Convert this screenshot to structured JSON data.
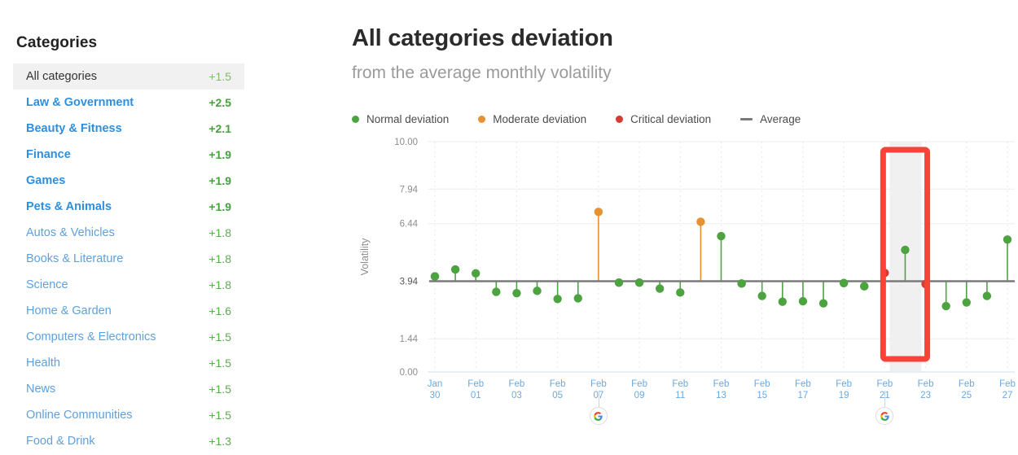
{
  "sidebar": {
    "title": "Categories",
    "items": [
      {
        "label": "All categories",
        "value": "+1.5",
        "selected": true,
        "strong": false,
        "value_color": "green"
      },
      {
        "label": "Law & Government",
        "value": "+2.5",
        "selected": false,
        "strong": true,
        "value_color": "orange"
      },
      {
        "label": "Beauty & Fitness",
        "value": "+2.1",
        "selected": false,
        "strong": true,
        "value_color": "green"
      },
      {
        "label": "Finance",
        "value": "+1.9",
        "selected": false,
        "strong": true,
        "value_color": "green"
      },
      {
        "label": "Games",
        "value": "+1.9",
        "selected": false,
        "strong": true,
        "value_color": "green"
      },
      {
        "label": "Pets & Animals",
        "value": "+1.9",
        "selected": false,
        "strong": true,
        "value_color": "green"
      },
      {
        "label": "Autos & Vehicles",
        "value": "+1.8",
        "selected": false,
        "strong": false,
        "value_color": "green"
      },
      {
        "label": "Books & Literature",
        "value": "+1.8",
        "selected": false,
        "strong": false,
        "value_color": "green"
      },
      {
        "label": "Science",
        "value": "+1.8",
        "selected": false,
        "strong": false,
        "value_color": "green"
      },
      {
        "label": "Home & Garden",
        "value": "+1.6",
        "selected": false,
        "strong": false,
        "value_color": "green"
      },
      {
        "label": "Computers & Electronics",
        "value": "+1.5",
        "selected": false,
        "strong": false,
        "value_color": "green"
      },
      {
        "label": "Health",
        "value": "+1.5",
        "selected": false,
        "strong": false,
        "value_color": "green"
      },
      {
        "label": "News",
        "value": "+1.5",
        "selected": false,
        "strong": false,
        "value_color": "green"
      },
      {
        "label": "Online Communities",
        "value": "+1.5",
        "selected": false,
        "strong": false,
        "value_color": "green"
      },
      {
        "label": "Food & Drink",
        "value": "+1.3",
        "selected": false,
        "strong": false,
        "value_color": "green"
      }
    ]
  },
  "header": {
    "title": "All categories deviation",
    "subtitle": "from the average monthly volatility"
  },
  "colors": {
    "normal": "#4ca340",
    "moderate": "#e59331",
    "critical": "#d23c32",
    "average_line": "#7a7a7a",
    "annotation_box": "#f9423a",
    "category_link": "#5fa0dc",
    "category_value": "#5cab4e",
    "axis_label": "#6aa9e0"
  },
  "markers": [
    {
      "name": "google-update-marker",
      "x_label": "Feb 07"
    },
    {
      "name": "google-update-marker",
      "x_label": "Feb 21"
    }
  ],
  "annotation": {
    "name": "highlight-box",
    "x_from": "Feb 21",
    "x_to": "Feb 22",
    "color": "#f9423a"
  },
  "chart_data": {
    "type": "scatter",
    "title": "All categories deviation",
    "subtitle": "from the average monthly volatility",
    "xlabel": "",
    "ylabel": "Volatility",
    "ylim": [
      0.0,
      10.0
    ],
    "ytick_values": [
      0.0,
      1.44,
      3.94,
      6.44,
      7.94,
      10.0
    ],
    "ytick_labels": [
      "0.00",
      "1.44",
      "3.94",
      "6.44",
      "7.94",
      "10.00"
    ],
    "average": 3.94,
    "average_label": "Average",
    "grid": true,
    "legend_position": "top-left",
    "legend": [
      {
        "label": "Normal deviation",
        "color": "#4ca340",
        "key": "normal"
      },
      {
        "label": "Moderate deviation",
        "color": "#e59331",
        "key": "moderate"
      },
      {
        "label": "Critical deviation",
        "color": "#d23c32",
        "key": "critical"
      },
      {
        "label": "Average",
        "color": "#7a7a7a",
        "key": "average"
      }
    ],
    "xtick_labels": [
      "Jan\n30",
      "Feb\n01",
      "Feb\n03",
      "Feb\n05",
      "Feb\n07",
      "Feb\n09",
      "Feb\n11",
      "Feb\n13",
      "Feb\n15",
      "Feb\n17",
      "Feb\n19",
      "Feb\n21",
      "Feb\n23",
      "Feb\n25",
      "Feb\n27"
    ],
    "points": [
      {
        "x_label": "Jan 30",
        "value": 4.15,
        "level": "normal"
      },
      {
        "x_label": "Jan 31",
        "value": 4.45,
        "level": "normal"
      },
      {
        "x_label": "Feb 01",
        "value": 4.28,
        "level": "normal"
      },
      {
        "x_label": "Feb 02",
        "value": 3.48,
        "level": "normal"
      },
      {
        "x_label": "Feb 03",
        "value": 3.42,
        "level": "normal"
      },
      {
        "x_label": "Feb 04",
        "value": 3.52,
        "level": "normal"
      },
      {
        "x_label": "Feb 05",
        "value": 3.17,
        "level": "normal"
      },
      {
        "x_label": "Feb 06",
        "value": 3.2,
        "level": "normal"
      },
      {
        "x_label": "Feb 07",
        "value": 6.95,
        "level": "moderate"
      },
      {
        "x_label": "Feb 08",
        "value": 3.88,
        "level": "normal"
      },
      {
        "x_label": "Feb 09",
        "value": 3.88,
        "level": "normal"
      },
      {
        "x_label": "Feb 10",
        "value": 3.62,
        "level": "normal"
      },
      {
        "x_label": "Feb 11",
        "value": 3.45,
        "level": "normal"
      },
      {
        "x_label": "Feb 12",
        "value": 6.52,
        "level": "moderate"
      },
      {
        "x_label": "Feb 13",
        "value": 5.9,
        "level": "normal"
      },
      {
        "x_label": "Feb 14",
        "value": 3.84,
        "level": "normal"
      },
      {
        "x_label": "Feb 15",
        "value": 3.3,
        "level": "normal"
      },
      {
        "x_label": "Feb 16",
        "value": 3.05,
        "level": "normal"
      },
      {
        "x_label": "Feb 17",
        "value": 3.07,
        "level": "normal"
      },
      {
        "x_label": "Feb 18",
        "value": 2.98,
        "level": "normal"
      },
      {
        "x_label": "Feb 19",
        "value": 3.86,
        "level": "normal"
      },
      {
        "x_label": "Feb 20",
        "value": 3.72,
        "level": "normal"
      },
      {
        "x_label": "Feb 21",
        "value": 4.3,
        "level": "critical"
      },
      {
        "x_label": "Feb 22",
        "value": 5.3,
        "level": "normal"
      },
      {
        "x_label": "Feb 23",
        "value": 3.82,
        "level": "critical"
      },
      {
        "x_label": "Feb 24",
        "value": 2.86,
        "level": "normal"
      },
      {
        "x_label": "Feb 25",
        "value": 3.02,
        "level": "normal"
      },
      {
        "x_label": "Feb 26",
        "value": 3.3,
        "level": "normal"
      },
      {
        "x_label": "Feb 27",
        "value": 5.75,
        "level": "normal"
      }
    ]
  }
}
